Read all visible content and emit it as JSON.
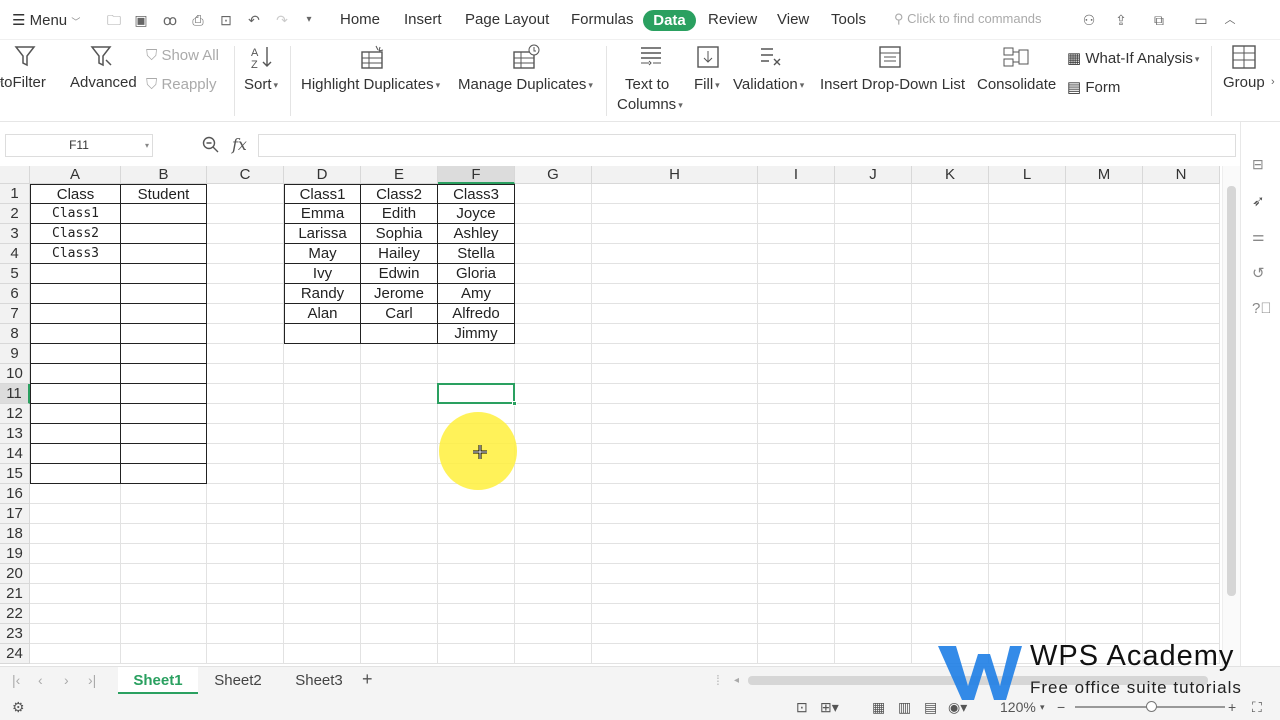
{
  "menubar": {
    "menu_label": "Menu",
    "tabs": [
      "Home",
      "Insert",
      "Page Layout",
      "Formulas",
      "Data",
      "Review",
      "View",
      "Tools"
    ],
    "active_tab": "Data",
    "search_placeholder": "Click to find commands"
  },
  "ribbon": {
    "autofilter": "toFilter",
    "advanced": "Advanced",
    "show_all": "Show All",
    "reapply": "Reapply",
    "sort": "Sort",
    "highlight_duplicates": "Highlight Duplicates",
    "manage_duplicates": "Manage Duplicates",
    "text_to_columns_1": "Text to",
    "text_to_columns_2": "Columns",
    "fill": "Fill",
    "validation": "Validation",
    "insert_dropdown": "Insert Drop-Down List",
    "consolidate": "Consolidate",
    "what_if": "What-If Analysis",
    "form": "Form",
    "group": "Group"
  },
  "formula_bar": {
    "name_box": "F11",
    "fx_label": "fx",
    "formula": ""
  },
  "sheet": {
    "columns": [
      "A",
      "B",
      "C",
      "D",
      "E",
      "F",
      "G",
      "H",
      "I",
      "J",
      "K",
      "L",
      "M",
      "N"
    ],
    "selected_column": "F",
    "selected_row": "11",
    "rows": [
      "1",
      "2",
      "3",
      "4",
      "5",
      "6",
      "7",
      "8",
      "9",
      "10",
      "11",
      "12",
      "13",
      "14",
      "15",
      "16",
      "17",
      "18",
      "19",
      "20",
      "21",
      "22",
      "23",
      "24"
    ],
    "table1": {
      "headers": [
        "Class",
        "Student"
      ],
      "class_values": [
        "Class1",
        "Class2",
        "Class3"
      ]
    },
    "table2": {
      "headers": [
        "Class1",
        "Class2",
        "Class3"
      ],
      "class1": [
        "Emma",
        "Larissa",
        "May",
        "Ivy",
        "Randy",
        "Alan"
      ],
      "class2": [
        "Edith",
        "Sophia",
        "Hailey",
        "Edwin",
        "Jerome",
        "Carl"
      ],
      "class3": [
        "Joyce",
        "Ashley",
        "Stella",
        "Gloria",
        "Amy",
        "Alfredo",
        "Jimmy"
      ]
    }
  },
  "sheet_tabs": [
    "Sheet1",
    "Sheet2",
    "Sheet3"
  ],
  "active_sheet": "Sheet1",
  "status": {
    "zoom": "120%"
  },
  "watermark": {
    "title": "WPS Academy",
    "subtitle": "Free office suite tutorials"
  },
  "colors": {
    "accent": "#2aa060",
    "highlight": "#fff03c"
  },
  "icons": [
    "menu-icon",
    "folder-icon",
    "save-icon",
    "undo-icon",
    "redo-icon",
    "print-icon",
    "filter-icon",
    "sort-icon",
    "fill-icon",
    "validation-icon",
    "group-icon",
    "zoom-icon"
  ]
}
